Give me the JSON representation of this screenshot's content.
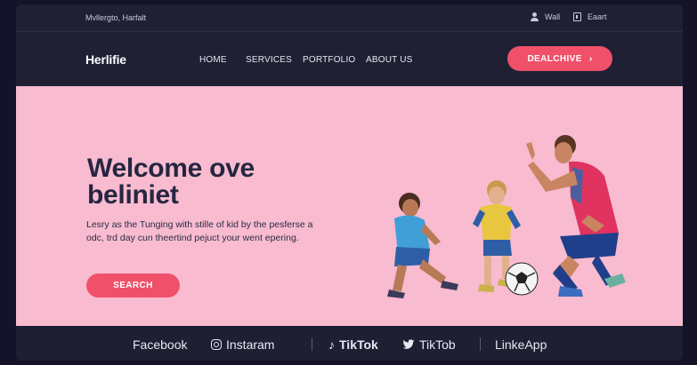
{
  "topbar": {
    "tagline": "Mvllergto, Harfalt",
    "user_label": "Wall",
    "cart_label": "Eaart"
  },
  "navbar": {
    "logo": "Herlifie",
    "links": [
      "HOME",
      "SERVICES",
      "PORTFOLIO",
      "ABOUT US"
    ],
    "cta_label": "DEALCHIVE",
    "cta_icon": "chevron-right-icon"
  },
  "hero": {
    "title_line1": "Welcome ove",
    "title_line2": "beliniet",
    "description": "Lesry as the Tunging with stille of kid by the pesferse a odc, trd day cun theertind pejuct your went epering.",
    "search_label": "SEARCH",
    "image": "kids-playing-soccer-with-coach"
  },
  "footer": {
    "social": [
      {
        "label": "Facebook",
        "icon": ""
      },
      {
        "label": "Instaram",
        "icon": "instagram-icon"
      },
      {
        "label": "TikTok",
        "icon": "tiktok-icon"
      },
      {
        "label": "TikTob",
        "icon": "twitter-icon"
      },
      {
        "label": "LinkeApp",
        "icon": ""
      }
    ]
  },
  "colors": {
    "background": "#15132a",
    "panel": "#1f2034",
    "hero": "#f8bbd0",
    "accent": "#f0506a",
    "heading": "#262640"
  }
}
